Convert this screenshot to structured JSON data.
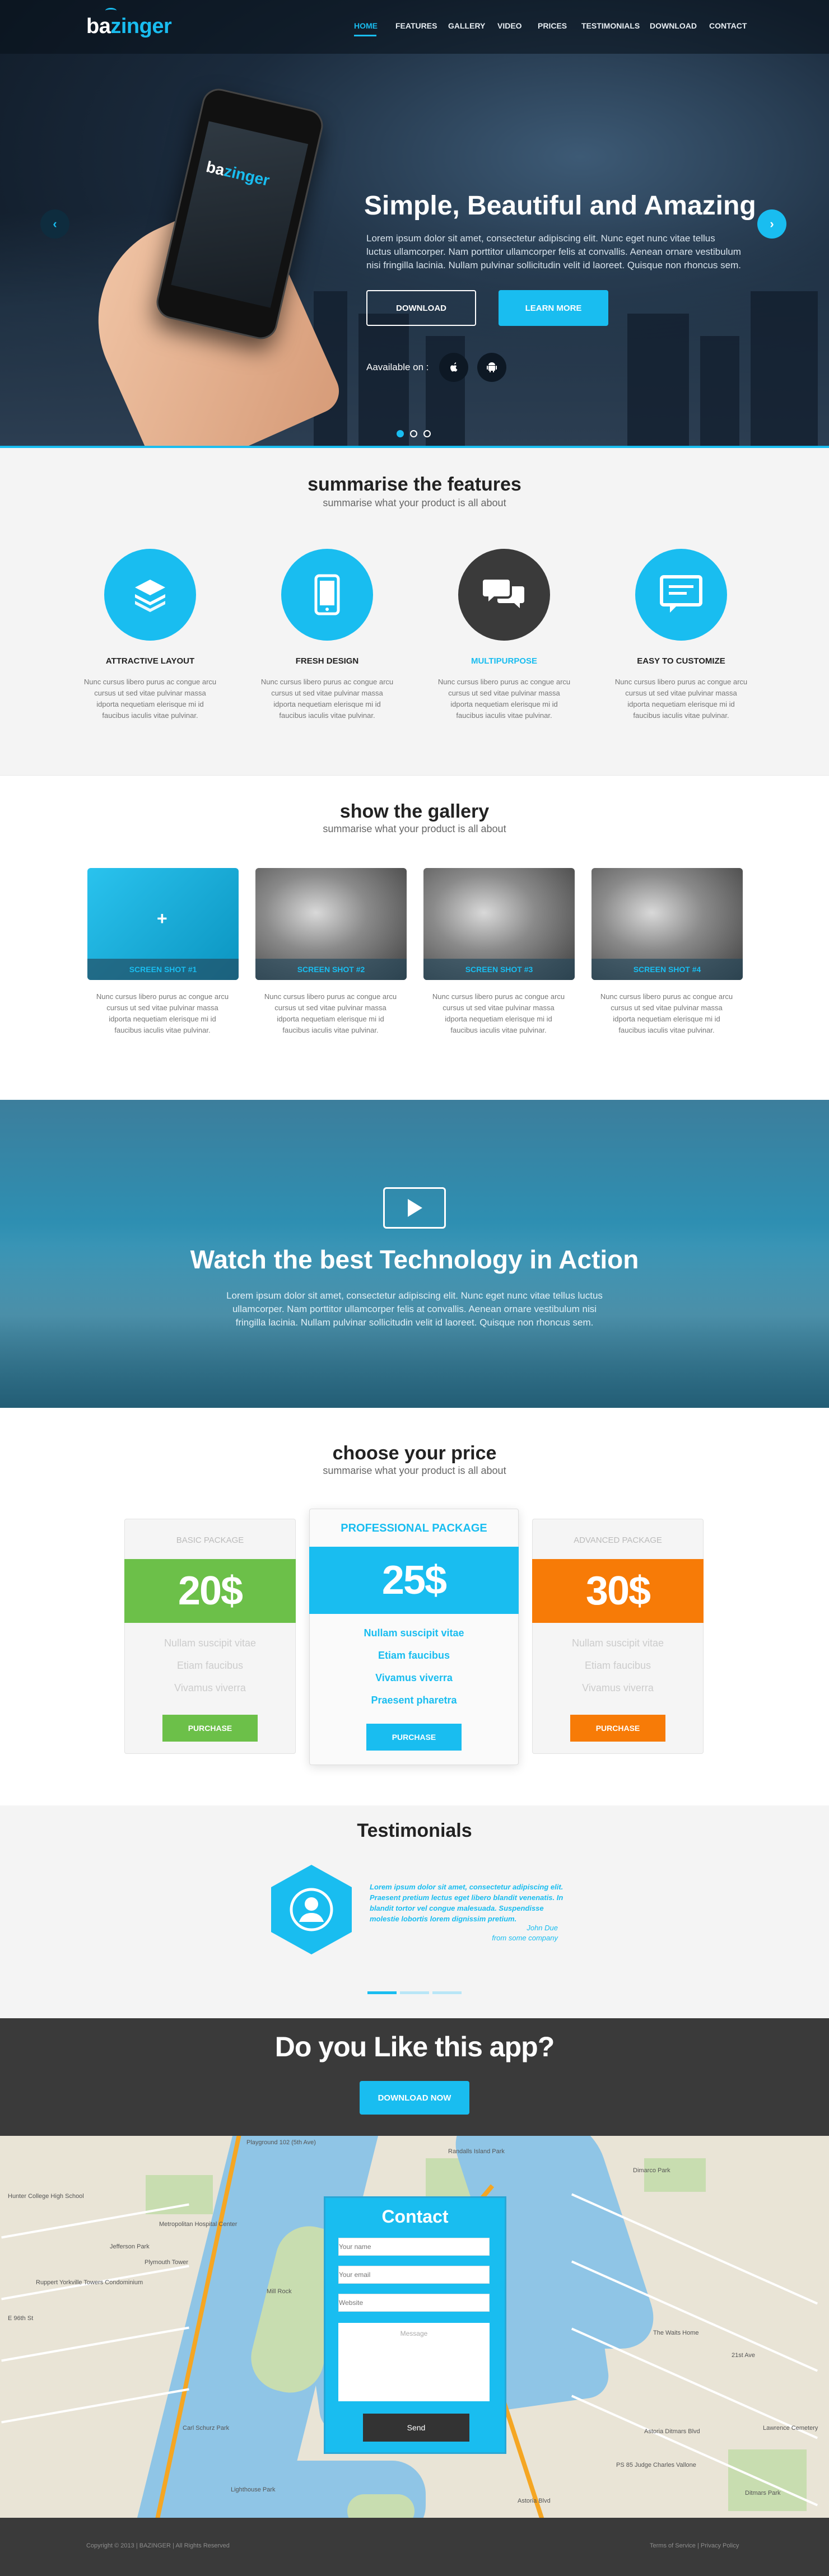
{
  "brand": {
    "name_prefix": "ba",
    "name_suffix": "zinger",
    "accent": "#19bdf0",
    "dark": "#3a3a3a"
  },
  "nav": {
    "items": [
      "HOME",
      "FEATURES",
      "GALLERY",
      "VIDEO",
      "PRICES",
      "TESTIMONIALS",
      "DOWNLOAD",
      "CONTACT"
    ],
    "active": "HOME"
  },
  "hero": {
    "title_regular": "Simple, Beautiful ",
    "title_bold": "and Amazing",
    "copy": "Lorem ipsum dolor sit amet, consectetur adipiscing elit. Nunc eget nunc vitae tellus luctus ullamcorper. Nam porttitor ullamcorper felis at convallis. Aenean ornare vestibulum nisi fringilla lacinia. Nullam pulvinar sollicitudin velit id laoreet. Quisque non rhoncus sem.",
    "download_label": "DOWNLOAD",
    "learn_label": "LEARN MORE",
    "available_label": "Aavailable on :",
    "prev_icon": "chevron-left-icon",
    "next_icon": "chevron-right-icon",
    "slides": 3,
    "active_slide": 1
  },
  "features": {
    "title": "summarise the features",
    "subtitle": "summarise what your product is all about",
    "items": [
      {
        "title": "ATTRACTIVE LAYOUT",
        "icon": "layers-icon",
        "text": "Nunc cursus libero purus ac congue arcu cursus ut sed vitae pulvinar massa idporta nequetiam elerisque mi id faucibus iaculis vitae pulvinar."
      },
      {
        "title": "FRESH DESIGN",
        "icon": "smartphone-icon",
        "text": "Nunc cursus libero purus ac congue arcu cursus ut sed vitae pulvinar massa idporta nequetiam elerisque mi id faucibus iaculis vitae pulvinar."
      },
      {
        "title": "MULTIPURPOSE",
        "icon": "chat-bubbles-icon",
        "text": "Nunc cursus libero purus ac congue arcu cursus ut sed vitae pulvinar massa idporta nequetiam elerisque mi id faucibus iaculis vitae pulvinar."
      },
      {
        "title": "EASY TO CUSTOMIZE",
        "icon": "message-screen-icon",
        "text": "Nunc cursus libero purus ac congue arcu cursus ut sed vitae pulvinar massa idporta nequetiam elerisque mi id faucibus iaculis vitae pulvinar."
      }
    ]
  },
  "gallery": {
    "title": "show the gallery",
    "subtitle": "summarise what your product is all about",
    "items": [
      {
        "caption": "SCREEN SHOT #1",
        "text": "Nunc cursus libero purus ac congue arcu cursus ut sed vitae pulvinar massa idporta nequetiam elerisque mi id faucibus iaculis vitae pulvinar."
      },
      {
        "caption": "SCREEN SHOT #2",
        "text": "Nunc cursus libero purus ac congue arcu cursus ut sed vitae pulvinar massa idporta nequetiam elerisque mi id faucibus iaculis vitae pulvinar."
      },
      {
        "caption": "SCREEN SHOT #3",
        "text": "Nunc cursus libero purus ac congue arcu cursus ut sed vitae pulvinar massa idporta nequetiam elerisque mi id faucibus iaculis vitae pulvinar."
      },
      {
        "caption": "SCREEN SHOT #4",
        "text": "Nunc cursus libero purus ac congue arcu cursus ut sed vitae pulvinar massa idporta nequetiam elerisque mi id faucibus iaculis vitae pulvinar."
      }
    ]
  },
  "video": {
    "title_regular": "Watch the best Technology in ",
    "title_bold": "Action",
    "copy": "Lorem ipsum dolor sit amet, consectetur adipiscing elit. Nunc eget nunc vitae tellus luctus ullamcorper. Nam porttitor ullamcorper felis at convallis. Aenean ornare vestibulum nisi fringilla lacinia. Nullam pulvinar sollicitudin velit id laoreet. Quisque non rhoncus sem."
  },
  "pricing": {
    "title": "choose your price",
    "subtitle": "summarise what your product is all about",
    "plans": [
      {
        "name": "BASIC PACKAGE",
        "price": "20$",
        "color": "#6cc049",
        "features": [
          "Nullam suscipit vitae",
          "Etiam faucibus",
          "Vivamus viverra"
        ],
        "cta": "PURCHASE"
      },
      {
        "name": "PROFESSIONAL PACKAGE",
        "price": "25$",
        "color": "#19bdf0",
        "features": [
          "Nullam suscipit vitae",
          "Etiam faucibus",
          "Vivamus viverra",
          "Praesent pharetra"
        ],
        "cta": "PURCHASE"
      },
      {
        "name": "ADVANCED PACKAGE",
        "price": "30$",
        "color": "#f77b07",
        "features": [
          "Nullam suscipit vitae",
          "Etiam faucibus",
          "Vivamus viverra"
        ],
        "cta": "PURCHASE"
      }
    ]
  },
  "testimonials": {
    "title": "Testimonials",
    "quote": "Lorem ipsum dolor sit amet, consectetur adipiscing elit. Praesent pretium lectus eget libero blandit venenatis. In blandit tortor vel congue malesuada. Suspendisse molestie lobortis lorem dignissim pretium.",
    "author": "John Due",
    "author_source": "from some company",
    "slides": 3,
    "active_slide": 1
  },
  "cta": {
    "title": "Do you Like this app?",
    "button": "DOWNLOAD NOW"
  },
  "map": {
    "labels": [
      "Playground 102 (5th Ave)",
      "Randalls Island Park",
      "Hunter College High School",
      "Metropolitan Hospital Center",
      "Jefferson Park",
      "Plymouth Tower",
      "Ruppert Yorkville Towers Condominium",
      "Mill Rock",
      "E 96th St",
      "Lighthouse Park",
      "Carl Schurz Park",
      "Astoria Blvd",
      "21st Ave",
      "The Waits Home",
      "Astoria Ditmars Blvd",
      "PS 85 Judge Charles Vallone",
      "Lawrence Cemetery",
      "Ditmars Park",
      "Dimarco Park"
    ]
  },
  "contact": {
    "title": "Contact",
    "fields": [
      "Your name",
      "Your email",
      "Website"
    ],
    "message_placeholder": "Message",
    "send_label": "Send"
  },
  "footer": {
    "copyright": "Copyright © 2013 | BAZINGER | All Rights Reserved",
    "links": "Terms of Service | Privacy Policy"
  }
}
